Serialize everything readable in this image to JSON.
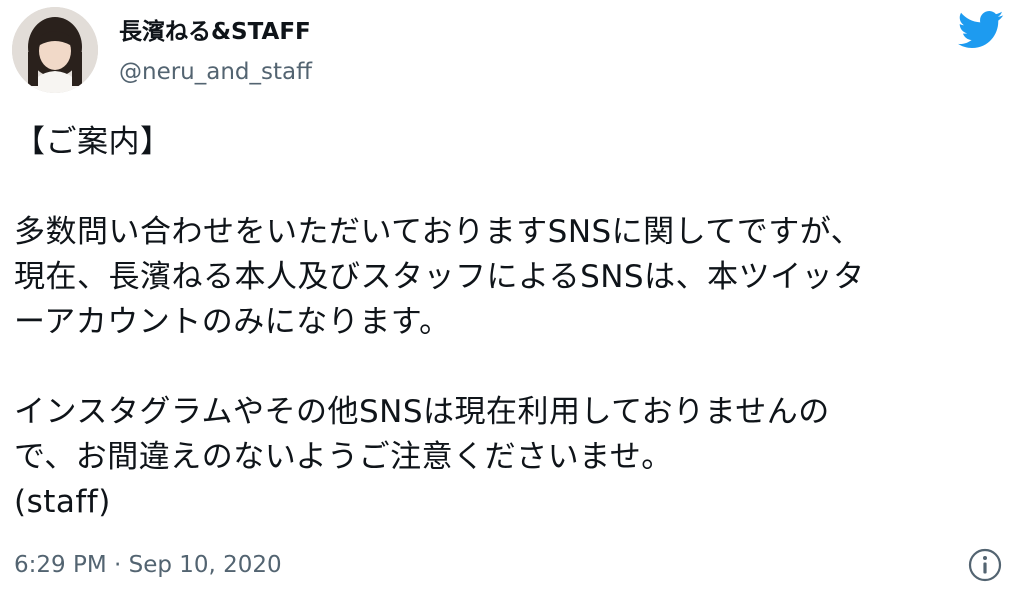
{
  "author": {
    "display_name": "長濱ねる&STAFF",
    "handle": "@neru_and_staff"
  },
  "icons": {
    "avatar": "profile-photo",
    "logo": "twitter-bird-icon",
    "info": "info-icon"
  },
  "colors": {
    "twitter_blue": "#1d9bf0",
    "text_primary": "#0f1419",
    "text_secondary": "#536471"
  },
  "tweet": {
    "lines": [
      "【ご案内】",
      "",
      "多数問い合わせをいただいておりますSNSに関してですが、",
      "現在、長濱ねる本人及びスタッフによるSNSは、本ツイッタ",
      "ーアカウントのみになります。",
      "",
      "インスタグラムやその他SNSは現在利用しておりませんの",
      "で、お間違えのないようご注意くださいませ。",
      "(staff)"
    ],
    "timestamp": "6:29 PM · Sep 10, 2020"
  }
}
